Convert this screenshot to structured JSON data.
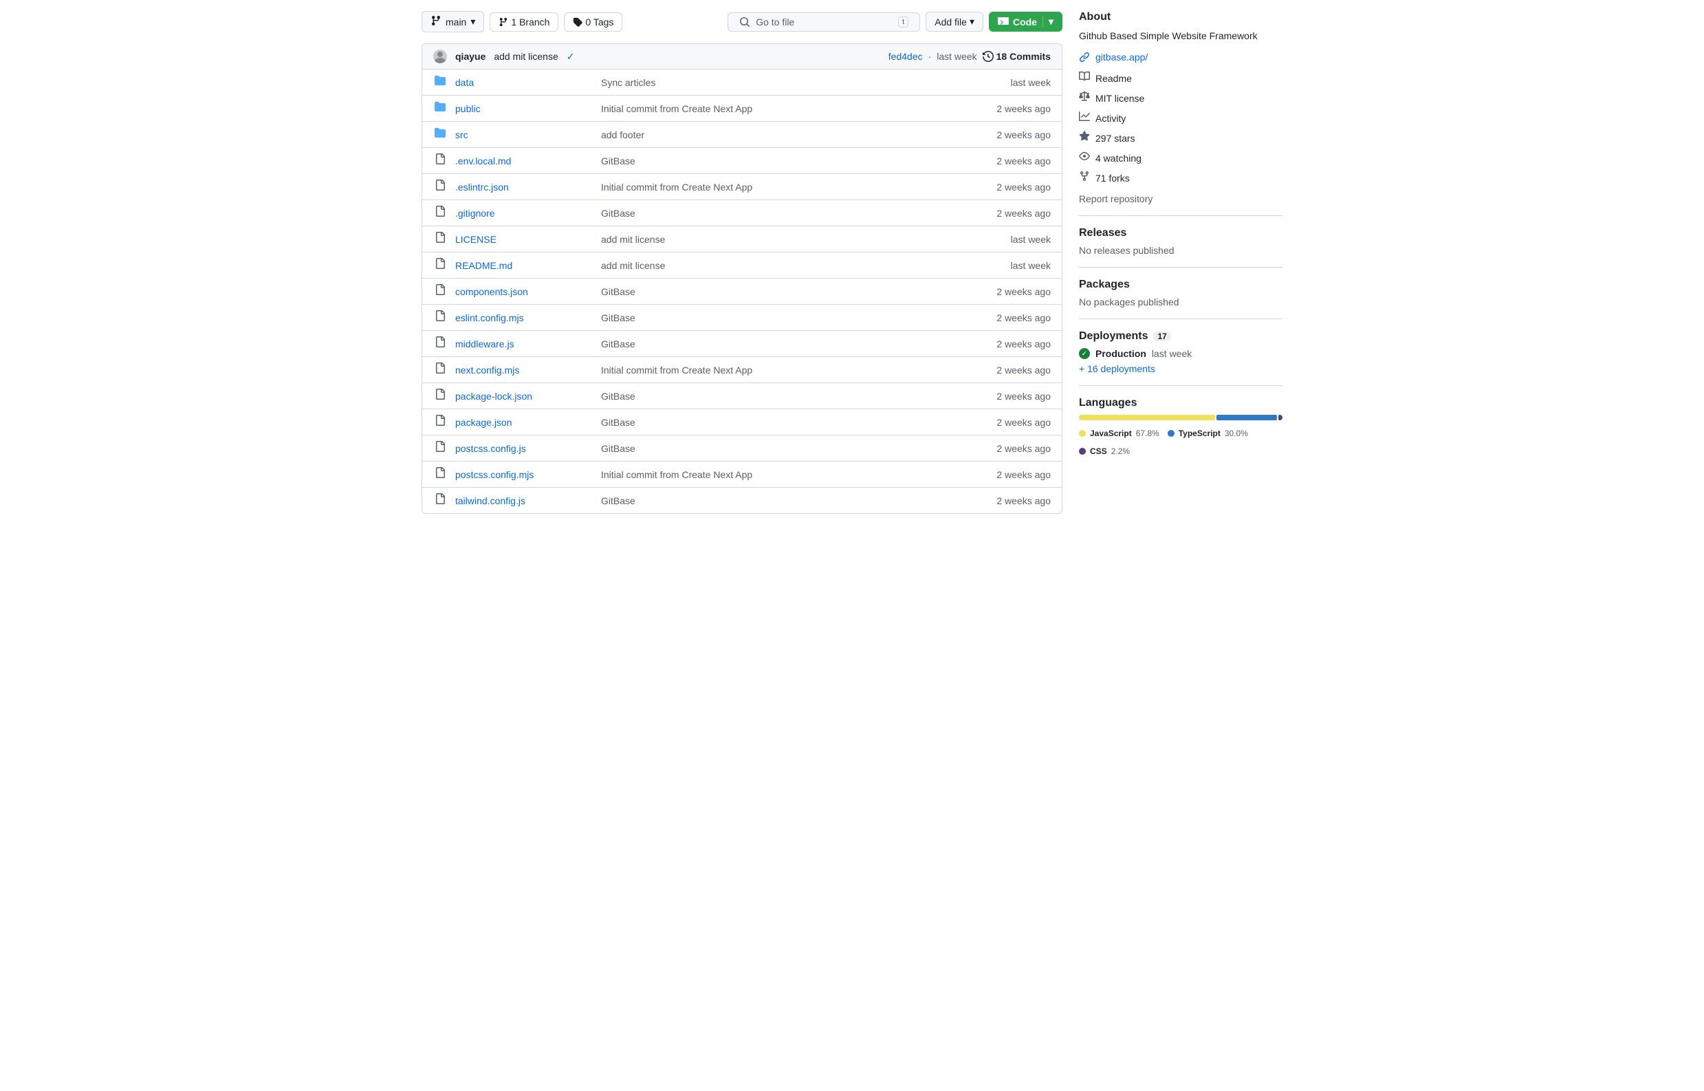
{
  "toolbar": {
    "branch_icon": "⎇",
    "branch_label": "main",
    "branch_dropdown": "▼",
    "branches_label": "1 Branch",
    "tags_label": "0 Tags",
    "search_placeholder": "Go to file",
    "search_shortcut": "t",
    "add_file_label": "Add file",
    "add_file_dropdown": "▼",
    "code_label": "Code",
    "code_dropdown": "▼"
  },
  "commit_row": {
    "author": "qiayue",
    "message": "add mit license",
    "check": "✓",
    "hash": "fed4dec",
    "time": "last week",
    "commits_icon": "⟳",
    "commits_count": "18 Commits"
  },
  "files": [
    {
      "type": "folder",
      "name": "data",
      "commit": "Sync articles",
      "time": "last week"
    },
    {
      "type": "folder",
      "name": "public",
      "commit": "Initial commit from Create Next App",
      "time": "2 weeks ago"
    },
    {
      "type": "folder",
      "name": "src",
      "commit": "add footer",
      "time": "2 weeks ago"
    },
    {
      "type": "file",
      "name": ".env.local.md",
      "commit": "GitBase",
      "time": "2 weeks ago"
    },
    {
      "type": "file",
      "name": ".eslintrc.json",
      "commit": "Initial commit from Create Next App",
      "time": "2 weeks ago"
    },
    {
      "type": "file",
      "name": ".gitignore",
      "commit": "GitBase",
      "time": "2 weeks ago"
    },
    {
      "type": "file",
      "name": "LICENSE",
      "commit": "add mit license",
      "time": "last week"
    },
    {
      "type": "file",
      "name": "README.md",
      "commit": "add mit license",
      "time": "last week"
    },
    {
      "type": "file",
      "name": "components.json",
      "commit": "GitBase",
      "time": "2 weeks ago"
    },
    {
      "type": "file",
      "name": "eslint.config.mjs",
      "commit": "GitBase",
      "time": "2 weeks ago"
    },
    {
      "type": "file",
      "name": "middleware.js",
      "commit": "GitBase",
      "time": "2 weeks ago"
    },
    {
      "type": "file",
      "name": "next.config.mjs",
      "commit": "Initial commit from Create Next App",
      "time": "2 weeks ago"
    },
    {
      "type": "file",
      "name": "package-lock.json",
      "commit": "GitBase",
      "time": "2 weeks ago"
    },
    {
      "type": "file",
      "name": "package.json",
      "commit": "GitBase",
      "time": "2 weeks ago"
    },
    {
      "type": "file",
      "name": "postcss.config.js",
      "commit": "GitBase",
      "time": "2 weeks ago"
    },
    {
      "type": "file",
      "name": "postcss.config.mjs",
      "commit": "Initial commit from Create Next App",
      "time": "2 weeks ago"
    },
    {
      "type": "file",
      "name": "tailwind.config.js",
      "commit": "GitBase",
      "time": "2 weeks ago"
    }
  ],
  "sidebar": {
    "about_title": "About",
    "description": "Github Based Simple Website Framework",
    "link_text": "gitbase.app/",
    "link_url": "#",
    "items": [
      {
        "icon": "📖",
        "label": "Readme"
      },
      {
        "icon": "⚖",
        "label": "MIT license"
      },
      {
        "icon": "📈",
        "label": "Activity"
      },
      {
        "icon": "☆",
        "label": "297 stars"
      },
      {
        "icon": "👁",
        "label": "4 watching"
      },
      {
        "icon": "⑂",
        "label": "71 forks"
      }
    ],
    "report_label": "Report repository",
    "releases_title": "Releases",
    "releases_empty": "No releases published",
    "packages_title": "Packages",
    "packages_empty": "No packages published",
    "deployments_title": "Deployments",
    "deployments_count": "17",
    "production_label": "Production",
    "production_time": "last week",
    "deployments_link": "+ 16 deployments",
    "languages_title": "Languages",
    "languages": [
      {
        "name": "JavaScript",
        "pct": "67.8%",
        "color": "#f1e05a",
        "width": 67.8
      },
      {
        "name": "TypeScript",
        "pct": "30.0%",
        "color": "#3178c6",
        "width": 30.0
      },
      {
        "name": "CSS",
        "pct": "2.2%",
        "color": "#563d7c",
        "width": 2.2
      }
    ]
  }
}
